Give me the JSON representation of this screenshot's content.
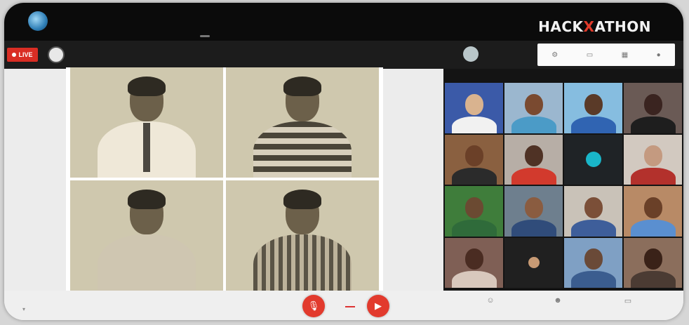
{
  "colors": {
    "accent": "#e23a2d",
    "topbar": "#0b0b0b",
    "infobar": "#1c1c1c",
    "video_panel": "#141414",
    "avatar_teal": "#19b6c9"
  },
  "header": {
    "org_title": "",
    "org_subtitle": "",
    "event_tag": "",
    "event_logo_a": "HACK",
    "event_logo_b": "ATHON",
    "event_year": ""
  },
  "info_bar": {
    "live_label": "LIVE",
    "presenting_text": "",
    "host_name": "",
    "host_role": "",
    "tools": [
      "gear-icon",
      "screen-icon",
      "layout-icon",
      "people-icon"
    ]
  },
  "presentation": {
    "slides": [
      {
        "name": "portrait-1"
      },
      {
        "name": "portrait-2"
      },
      {
        "name": "portrait-3"
      },
      {
        "name": "portrait-4"
      }
    ]
  },
  "video_grid": {
    "tiles": [
      {
        "bg": "#3b5aa8",
        "face": "#d9b38f",
        "torso": "#f1f1f1",
        "kind": "face"
      },
      {
        "bg": "#9bb7cf",
        "face": "#7a4a30",
        "torso": "#4b9bc7",
        "kind": "face"
      },
      {
        "bg": "#86bde0",
        "face": "#5a3a28",
        "torso": "#3064b2",
        "kind": "face"
      },
      {
        "bg": "#6a5a55",
        "face": "#3a2420",
        "torso": "#1e1e1e",
        "kind": "face"
      },
      {
        "bg": "#8a6040",
        "face": "#6b4028",
        "torso": "#2b2b2b",
        "kind": "face"
      },
      {
        "bg": "#b7aea6",
        "face": "#4f3225",
        "torso": "#d23a2d",
        "kind": "face"
      },
      {
        "kind": "avatar"
      },
      {
        "bg": "#d2c9c0",
        "face": "#c49a80",
        "torso": "#b3312c",
        "kind": "face"
      },
      {
        "bg": "#3f7d3b",
        "face": "#6b4a32",
        "torso": "#2f6b3a",
        "kind": "face"
      },
      {
        "bg": "#6e7f8e",
        "face": "#8a5c40",
        "torso": "#304c7a",
        "kind": "face"
      },
      {
        "bg": "#c9c2b8",
        "face": "#7b4f38",
        "torso": "#3e5e9a",
        "kind": "face"
      },
      {
        "bg": "#b88a66",
        "face": "#6a4028",
        "torso": "#5a8fd0",
        "kind": "face"
      },
      {
        "bg": "#7f5f55",
        "face": "#4a2c22",
        "torso": "#d8c8bd",
        "kind": "face"
      },
      {
        "kind": "small-avatar"
      },
      {
        "bg": "#7fa0c4",
        "face": "#6a4a38",
        "torso": "#3b5d8f",
        "kind": "face"
      },
      {
        "bg": "#8b6e5c",
        "face": "#3a2218",
        "torso": "#4b3b33",
        "kind": "face"
      }
    ]
  },
  "bottom_bar": {
    "layout_label": "",
    "mic_icon": "mic-icon",
    "cam_icon": "camera-icon",
    "items": [
      {
        "icon": "person-icon",
        "label": ""
      },
      {
        "icon": "people-icon",
        "label": ""
      },
      {
        "icon": "screen-share-icon",
        "label": ""
      }
    ]
  }
}
